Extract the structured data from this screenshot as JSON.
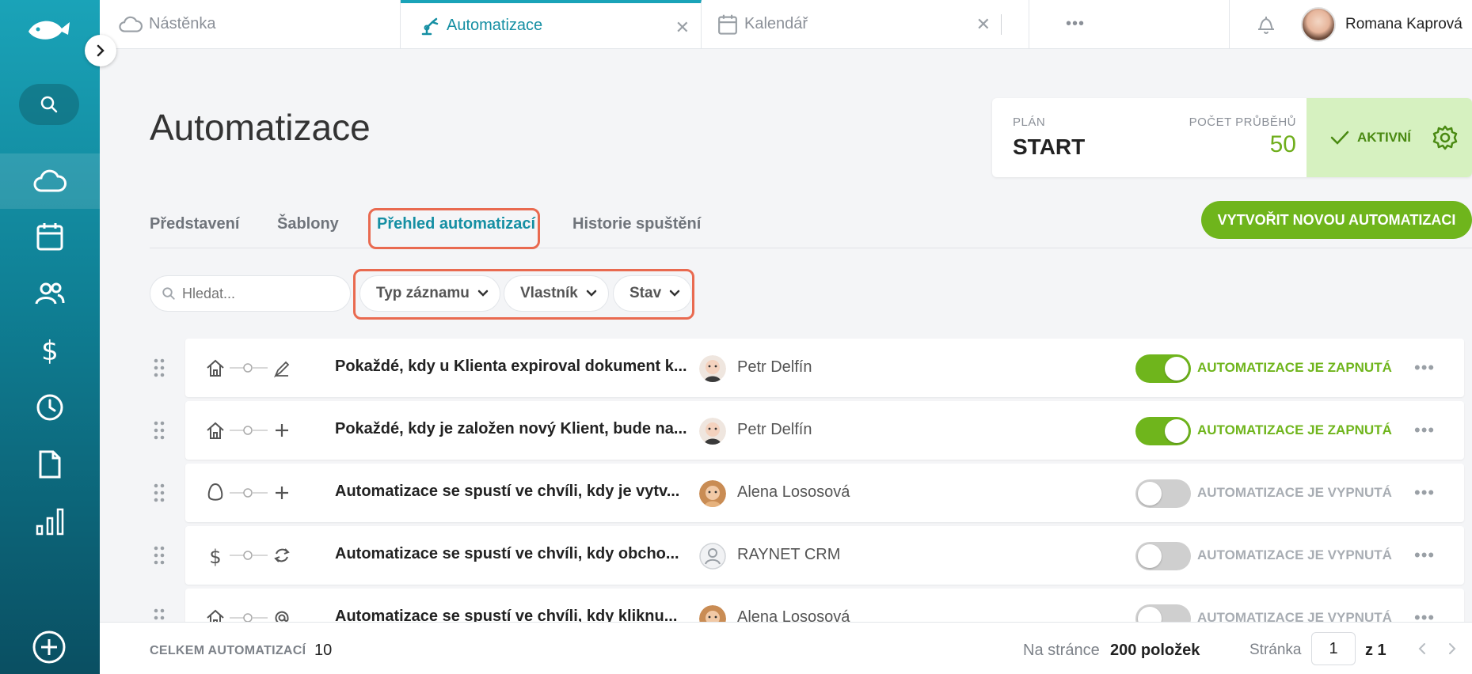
{
  "topbar": {
    "tabs": [
      {
        "label": "Nástěnka",
        "icon": "cloud-icon"
      },
      {
        "label": "Automatizace",
        "icon": "robot-arm-icon",
        "active": true
      },
      {
        "label": "Kalendář",
        "icon": "calendar-icon"
      }
    ],
    "more": "•••",
    "user_name": "Romana Kaprová"
  },
  "header": {
    "title": "Automatizace",
    "plan_label": "PLÁN",
    "plan_value": "START",
    "runs_label": "POČET PRŮBĚHŮ",
    "runs_value": "50",
    "status_label": "AKTIVNÍ"
  },
  "subtabs": [
    {
      "label": "Představení"
    },
    {
      "label": "Šablony"
    },
    {
      "label": "Přehled automatizací",
      "active": true
    },
    {
      "label": "Historie spuštění"
    }
  ],
  "create_button": "VYTVOŘIT NOVOU AUTOMATIZACI",
  "search": {
    "placeholder": "Hledat..."
  },
  "filters": [
    {
      "label": "Typ záznamu"
    },
    {
      "label": "Vlastník"
    },
    {
      "label": "Stav"
    }
  ],
  "rows": [
    {
      "title": "Pokaždé, kdy u Klienta expiroval dokument k...",
      "owner": "Petr Delfín",
      "enabled": true,
      "status": "AUTOMATIZACE JE ZAPNUTÁ",
      "trigger_icon": "house-icon",
      "action_icon": "pen-icon"
    },
    {
      "title": "Pokaždé, kdy je založen nový Klient, bude na...",
      "owner": "Petr Delfín",
      "enabled": true,
      "status": "AUTOMATIZACE JE ZAPNUTÁ",
      "trigger_icon": "house-icon",
      "action_icon": "plus-icon"
    },
    {
      "title": "Automatizace se spustí ve chvíli, kdy je vytv...",
      "owner": "Alena Lososová",
      "enabled": false,
      "status": "AUTOMATIZACE JE VYPNUTÁ",
      "trigger_icon": "egg-icon",
      "action_icon": "plus-icon"
    },
    {
      "title": "Automatizace se spustí ve chvíli, kdy obcho...",
      "owner": "RAYNET CRM",
      "enabled": false,
      "status": "AUTOMATIZACE JE VYPNUTÁ",
      "trigger_icon": "dollar-icon",
      "action_icon": "refresh-icon"
    },
    {
      "title": "Automatizace se spustí ve chvíli, kdy kliknu...",
      "owner": "Alena Lososová",
      "enabled": false,
      "status": "AUTOMATIZACE JE VYPNUTÁ",
      "trigger_icon": "house-icon",
      "action_icon": "at-icon"
    }
  ],
  "footer": {
    "total_label": "CELKEM AUTOMATIZACÍ",
    "total_value": "10",
    "per_page_label": "Na stránce",
    "per_page_value": "200 položek",
    "page_label": "Stránka",
    "page_value": "1",
    "page_of": "z 1"
  },
  "colors": {
    "accent": "#1aa3b8",
    "green": "#6fb51c",
    "highlight": "#e96a50"
  }
}
